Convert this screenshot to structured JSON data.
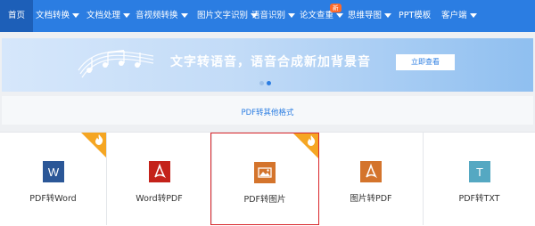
{
  "nav": {
    "items": [
      {
        "label": "首页",
        "dropdown": false,
        "active": true
      },
      {
        "label": "文档转换",
        "dropdown": true
      },
      {
        "label": "文档处理",
        "dropdown": true
      },
      {
        "label": "音视频转换",
        "dropdown": true
      },
      {
        "label": "图片文字识别",
        "dropdown": true
      },
      {
        "label": "语音识别",
        "dropdown": true
      },
      {
        "label": "论文查重",
        "dropdown": true,
        "badge": "新"
      },
      {
        "label": "思维导图",
        "dropdown": true
      },
      {
        "label": "PPT模板",
        "dropdown": false
      },
      {
        "label": "客户端",
        "dropdown": true
      }
    ]
  },
  "banner": {
    "headline": "文字转语音，语音合成新加背景音",
    "button": "立即查看",
    "carousel": {
      "count": 2,
      "active": 2
    }
  },
  "sub_link": "PDF转其他格式",
  "cards": [
    {
      "label": "PDF转Word",
      "icon": "word-icon",
      "color": "#2b5797",
      "glyph": "W",
      "hot": true,
      "selected": false
    },
    {
      "label": "Word转PDF",
      "icon": "pdf-icon",
      "color": "#c4221a",
      "glyph": "pdf",
      "hot": false,
      "selected": false
    },
    {
      "label": "PDF转图片",
      "icon": "image-icon",
      "color": "#d4742c",
      "glyph": "img",
      "hot": true,
      "selected": true
    },
    {
      "label": "图片转PDF",
      "icon": "pdf-icon",
      "color": "#d4742c",
      "glyph": "pdf",
      "hot": false,
      "selected": false
    },
    {
      "label": "PDF转TXT",
      "icon": "txt-icon",
      "color": "#55a8c2",
      "glyph": "T",
      "hot": false,
      "selected": false
    }
  ],
  "colors": {
    "nav_bg": "#2b7de2",
    "nav_active": "#1d5fb8",
    "accent": "#2b7de2",
    "hot_badge": "#f5a623",
    "selection_border": "#d9262b"
  }
}
